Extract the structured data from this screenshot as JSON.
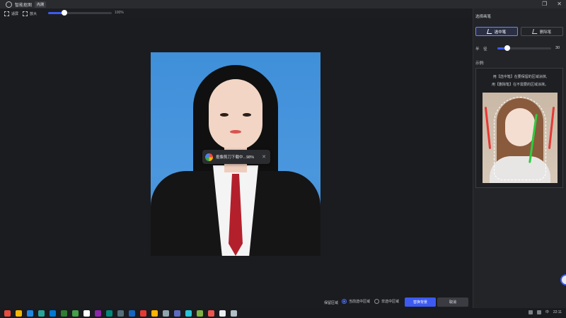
{
  "titlebar": {
    "title": "智能抠图",
    "badge": "内测"
  },
  "toolbar": {
    "adapt_label": "适屏",
    "enlarge_label": "放大",
    "zoom_percent": "100%",
    "zoom_level": 0.26
  },
  "toast": {
    "text": "抠像剪刀下载中...98%",
    "progress_percent": 98
  },
  "bottombar": {
    "keep_area_label": "保留区域",
    "option_current": "当前选中区域",
    "option_other": "非选中区域",
    "selected_option": "当前选中区域",
    "replace_button": "替换背景",
    "cancel_button": "取消"
  },
  "panel": {
    "title": "选择画笔",
    "select_pen": "选中笔",
    "erase_pen": "删除笔",
    "active_pen": "选中笔",
    "radius_label": "半　径",
    "radius_value": "30",
    "example_label": "示例:",
    "example_line1": "用【选中笔】在要保留的区域涂抹,",
    "example_line2": "用【删除笔】在不需要的区域涂抹。"
  },
  "taskbar": {
    "time": "22:11",
    "ime": "中",
    "icon_colors": [
      "#e94b3c",
      "#f5b800",
      "#1e88e5",
      "#26a69a",
      "#0078d4",
      "#2e7d32",
      "#43a047",
      "#ffffff",
      "#8e24aa",
      "#00897b",
      "#546e7a",
      "#1565c0",
      "#e53935",
      "#ffb300",
      "#90a4ae",
      "#5c6bc0",
      "#26c6da",
      "#7cb342",
      "#ef5350",
      "#eceff1",
      "#b0bec5"
    ]
  },
  "colors": {
    "accent": "#3d5af1",
    "photo_background": "#4a95de"
  }
}
